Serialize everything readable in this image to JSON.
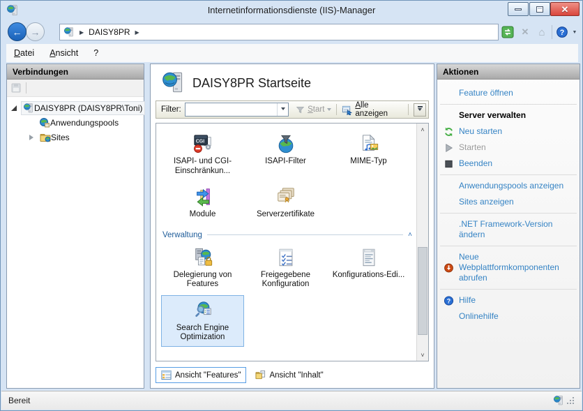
{
  "colors": {
    "accent_link": "#3583c4",
    "group_header_blue": "#1e5c99",
    "selected_tile_bg": "#dcebfb",
    "selected_tile_border": "#7eb2e4",
    "close_button_red": "#d9453c",
    "frame_blue": "#d6e4f4"
  },
  "window": {
    "title": "Internetinformationsdienste (IIS)-Manager"
  },
  "toolbar": {
    "breadcrumb_root": "DAISY8PR"
  },
  "menu": {
    "items": [
      {
        "label": "Datei",
        "accel": true
      },
      {
        "label": "Ansicht",
        "accel": true
      },
      {
        "label": "?"
      }
    ]
  },
  "connections": {
    "header": "Verbindungen",
    "tree": [
      {
        "label": "DAISY8PR (DAISY8PR\\Toni)",
        "icon": "iis-logo-icon",
        "expander": "expanded",
        "level": 0,
        "selected": true
      },
      {
        "label": "Anwendungspools",
        "icon": "app-pools-icon",
        "level": 1
      },
      {
        "label": "Sites",
        "icon": "sites-folder-icon",
        "expander": "collapsed",
        "level": 1
      }
    ]
  },
  "main": {
    "title": "DAISY8PR Startseite",
    "filter": {
      "label": "Filter:",
      "start_label": "Start",
      "show_all_label": "Alle anzeigen"
    },
    "groups": [
      {
        "name": "",
        "items": [
          {
            "label": "ISAPI- und CGI-Einschränkun...",
            "icon": "cgi-restrictions-icon"
          },
          {
            "label": "ISAPI-Filter",
            "icon": "isapi-filter-icon"
          },
          {
            "label": "MIME-Typ",
            "icon": "mime-type-icon"
          },
          {
            "label": "Module",
            "icon": "modules-icon"
          },
          {
            "label": "Serverzertifikate",
            "icon": "server-certificates-icon"
          }
        ]
      },
      {
        "name": "Verwaltung",
        "items": [
          {
            "label": "Delegierung von Features",
            "icon": "feature-delegation-icon"
          },
          {
            "label": "Freigegebene Konfiguration",
            "icon": "shared-config-icon"
          },
          {
            "label": "Konfigurations-Edi...",
            "icon": "config-editor-icon"
          },
          {
            "label": "Search Engine Optimization",
            "icon": "seo-icon",
            "selected": true
          }
        ]
      }
    ],
    "tabs": [
      {
        "label": "Ansicht \"Features\"",
        "icon": "features-view-icon",
        "selected": true
      },
      {
        "label": "Ansicht \"Inhalt\"",
        "icon": "content-view-icon"
      }
    ]
  },
  "actions": {
    "header": "Aktionen",
    "groups": [
      {
        "items": [
          {
            "label": "Feature öffnen",
            "type": "link"
          }
        ]
      },
      {
        "items": [
          {
            "label": "Server verwalten",
            "type": "heading"
          },
          {
            "label": "Neu starten",
            "type": "link",
            "icon": "restart-icon"
          },
          {
            "label": "Starten",
            "type": "disabled",
            "icon": "start-icon"
          },
          {
            "label": "Beenden",
            "type": "link",
            "icon": "stop-icon"
          }
        ]
      },
      {
        "items": [
          {
            "label": "Anwendungspools anzeigen",
            "type": "link"
          },
          {
            "label": "Sites anzeigen",
            "type": "link"
          }
        ]
      },
      {
        "items": [
          {
            "label": ".NET Framework-Version ändern",
            "type": "link"
          }
        ]
      },
      {
        "items": [
          {
            "label": "Neue Webplattformkomponenten abrufen",
            "type": "link",
            "icon": "download-icon"
          }
        ]
      },
      {
        "items": [
          {
            "label": "Hilfe",
            "type": "link",
            "icon": "help-icon"
          },
          {
            "label": "Onlinehilfe",
            "type": "link"
          }
        ]
      }
    ]
  },
  "statusbar": {
    "text": "Bereit"
  }
}
